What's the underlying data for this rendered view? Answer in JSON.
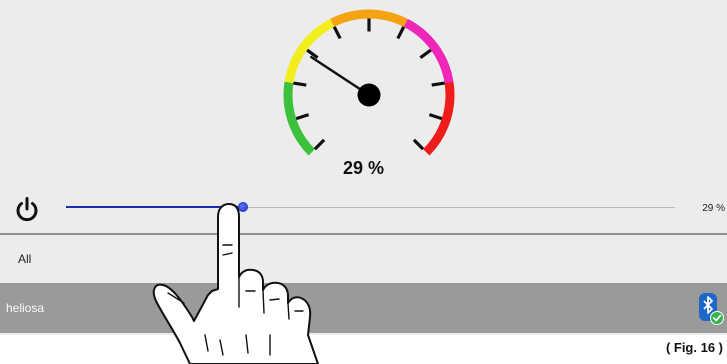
{
  "gauge": {
    "value_percent": 29,
    "label": "29 %",
    "zone_colors": [
      "#3cc13c",
      "#f2ee1d",
      "#f5a312",
      "#ef27b8",
      "#ef1c1c"
    ]
  },
  "controls": {
    "power_icon": "power-icon",
    "slider_value_fraction": 0.29,
    "slider_value_label": "29 %"
  },
  "groups": [
    {
      "label": "All"
    }
  ],
  "devices": [
    {
      "name": "heliosa",
      "status_icon": "bluetooth-connected-icon"
    }
  ],
  "caption": "( Fig. 16 )"
}
